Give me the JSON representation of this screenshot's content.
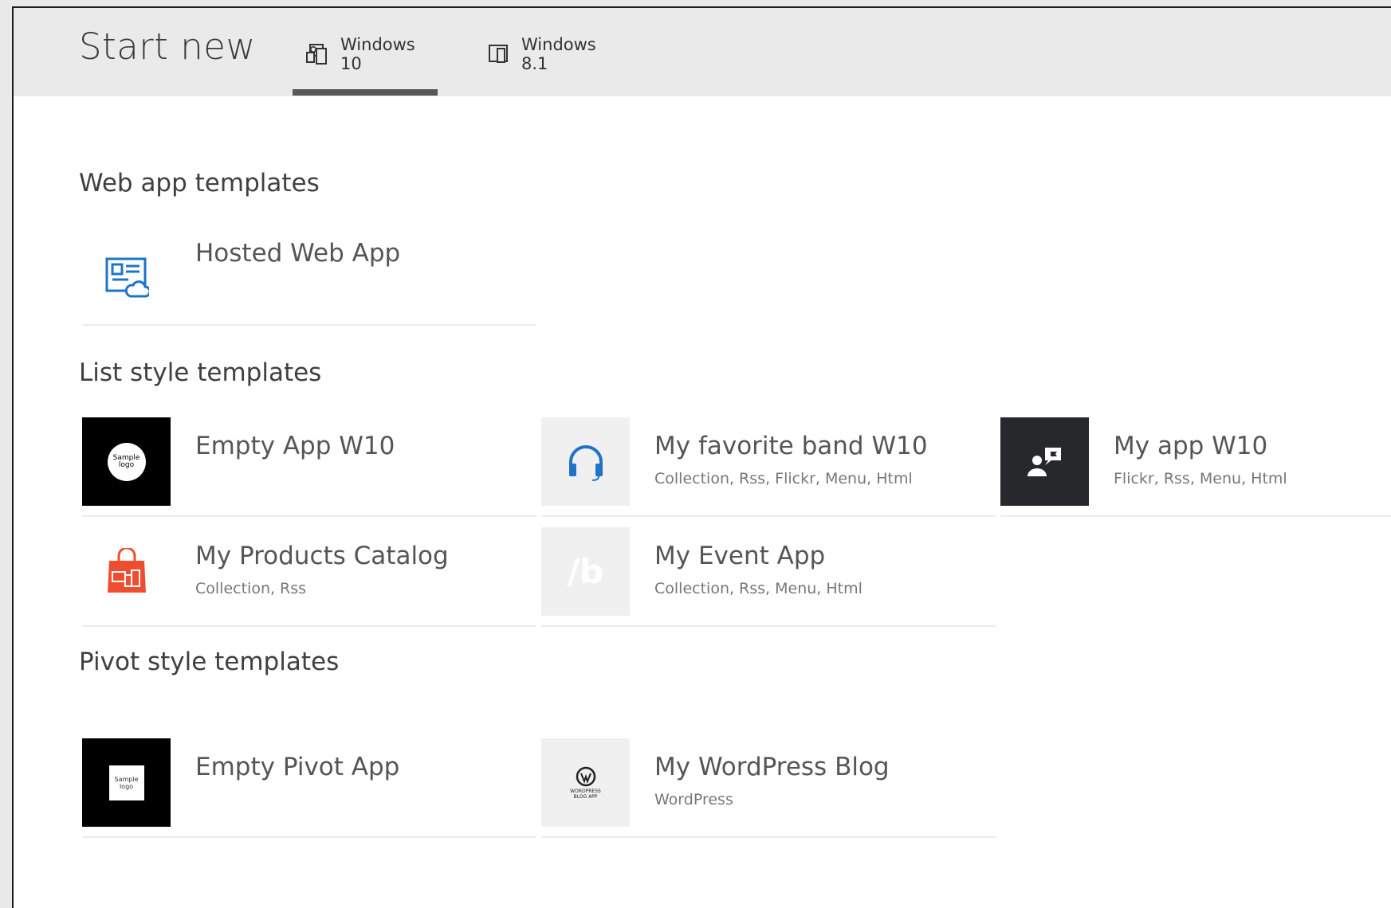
{
  "header": {
    "title": "Start new",
    "tabs": [
      {
        "label": "Windows 10",
        "active": true
      },
      {
        "label": "Windows 8.1",
        "active": false
      }
    ]
  },
  "sections": {
    "web": {
      "title": "Web app templates",
      "items": [
        {
          "name": "Hosted Web App",
          "sub": "",
          "icon": "web-app-cloud-icon"
        }
      ]
    },
    "list": {
      "title": "List style templates",
      "items": [
        {
          "name": "Empty App W10",
          "sub": "",
          "icon": "sample-logo-icon",
          "logo_text": [
            "Sample",
            "logo"
          ]
        },
        {
          "name": "My favorite band W10",
          "sub": "Collection, Rss, Flickr, Menu, Html",
          "icon": "headphones-icon"
        },
        {
          "name": "My app W10",
          "sub": "Flickr, Rss, Menu, Html",
          "icon": "person-chat-icon"
        },
        {
          "name": "My Products Catalog",
          "sub": "Collection, Rss",
          "icon": "shopping-bag-icon"
        },
        {
          "name": "My Event App",
          "sub": "Collection, Rss, Menu, Html",
          "icon": "slash-b-icon",
          "glyph": "/b"
        }
      ]
    },
    "pivot": {
      "title": "Pivot style templates",
      "items": [
        {
          "name": "Empty Pivot App",
          "sub": "",
          "icon": "sample-logo-square-icon",
          "logo_text": [
            "Sample",
            "logo"
          ]
        },
        {
          "name": "My WordPress Blog",
          "sub": "WordPress",
          "icon": "wordpress-icon",
          "logo_text": [
            "WORDPRESS",
            "BLOG APP"
          ]
        }
      ]
    }
  },
  "colors": {
    "accent_blue": "#1f74c9",
    "tile_dark": "#000000",
    "tile_charcoal": "#27282b",
    "tile_light": "#f0f0f0",
    "bag_red": "#ee4e2f",
    "tab_underline": "#585858"
  }
}
